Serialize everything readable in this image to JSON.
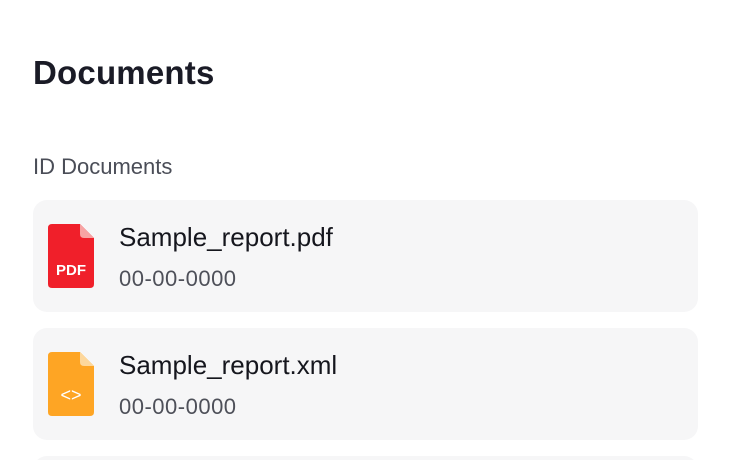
{
  "page": {
    "title": "Documents"
  },
  "section": {
    "label": "ID Documents"
  },
  "documents": [
    {
      "name": "Sample_report.pdf",
      "date": "00-00-0000",
      "icon": "pdf-file-icon",
      "icon_label": "PDF",
      "color": "#f01f2a",
      "fold_color": "#f7a3a3"
    },
    {
      "name": "Sample_report.xml",
      "date": "00-00-0000",
      "icon": "code-file-icon",
      "icon_label": "<>",
      "color": "#fea524",
      "fold_color": "#fdd79b"
    }
  ]
}
